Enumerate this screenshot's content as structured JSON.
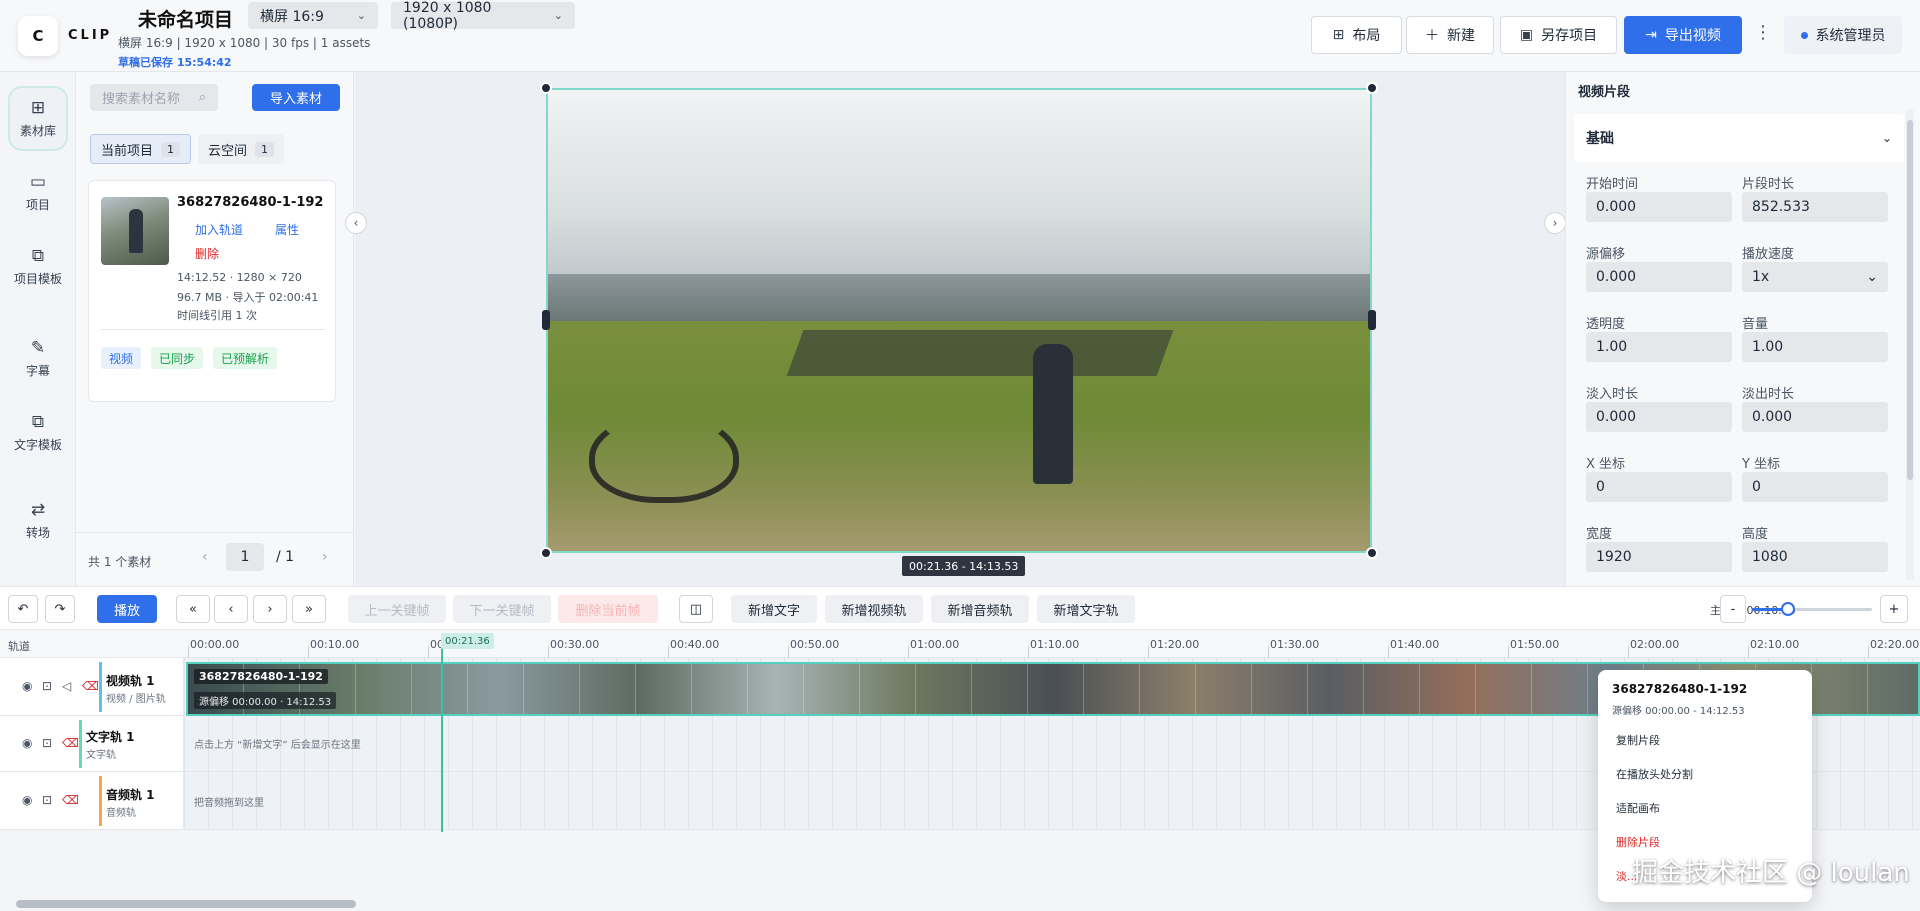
{
  "header": {
    "logo_letter": "C",
    "logo_text": "CLIP",
    "project_title": "未命名项目",
    "project_meta": "横屏 16:9 | 1920 x 1080 | 30 fps | 1 assets",
    "saved_text": "草稿已保存 15:54:42",
    "aspect_select": "横屏 16:9",
    "resolution_select": "1920 x 1080 (1080P)",
    "layout_btn": "布局",
    "new_btn": "新建",
    "save_as_btn": "另存项目",
    "export_btn": "导出视频",
    "admin": "系统管理员"
  },
  "nav": {
    "items": [
      {
        "label": "素材库",
        "icon": "grid-icon"
      },
      {
        "label": "项目",
        "icon": "folder-icon"
      },
      {
        "label": "项目模板",
        "icon": "template-icon"
      },
      {
        "label": "字幕",
        "icon": "pen-icon"
      },
      {
        "label": "文字模板",
        "icon": "text-template-icon"
      },
      {
        "label": "转场",
        "icon": "transition-icon"
      }
    ]
  },
  "assets": {
    "search_placeholder": "搜索素材名称",
    "import_btn": "导入素材",
    "tab_current": "当前项目",
    "tab_current_count": "1",
    "tab_cloud": "云空间",
    "tab_cloud_count": "1",
    "card": {
      "name": "36827826480-1-192",
      "add_to_track": "加入轨道",
      "properties": "属性",
      "delete": "删除",
      "info1": "14:12.52 · 1280 × 720",
      "info2": "96.7 MB · 导入于 02:00:41",
      "info3": "时间线引用 1 次",
      "tag_video": "视频",
      "tag_synced": "已同步",
      "tag_parsed": "已预解析"
    },
    "footer_count": "共 1 个素材",
    "page_current": "1",
    "page_total": "/ 1"
  },
  "preview": {
    "timecode": "00:21.36 - 14:13.53"
  },
  "props": {
    "title": "视频片段",
    "section": "基础",
    "fields": [
      {
        "label": "开始时间",
        "value": "0.000"
      },
      {
        "label": "片段时长",
        "value": "852.533"
      },
      {
        "label": "源偏移",
        "value": "0.000"
      },
      {
        "label": "播放速度",
        "value": "1x"
      },
      {
        "label": "透明度",
        "value": "1.00"
      },
      {
        "label": "音量",
        "value": "1.00"
      },
      {
        "label": "淡入时长",
        "value": "0.000"
      },
      {
        "label": "淡出时长",
        "value": "0.000"
      },
      {
        "label": "X 坐标",
        "value": "0"
      },
      {
        "label": "Y 坐标",
        "value": "0"
      },
      {
        "label": "宽度",
        "value": "1920"
      },
      {
        "label": "高度",
        "value": "1080"
      }
    ]
  },
  "toolbar": {
    "play": "播放",
    "prev_key": "上一关键帧",
    "next_key": "下一关键帧",
    "del_key": "删除当前帧",
    "add_text": "新增文字",
    "add_video_track": "新增视频轨",
    "add_audio_track": "新增音频轨",
    "add_text_track": "新增文字轨",
    "zoom_label": "主刻度 00:10.00",
    "zoom_minus": "-",
    "zoom_plus": "+",
    "zoom_level": 0.3
  },
  "timeline": {
    "header_label": "轨道",
    "ticks": [
      "00:00.00",
      "00:10.00",
      "00:20.00",
      "00:30.00",
      "00:40.00",
      "00:50.00",
      "01:00.00",
      "01:10.00",
      "01:20.00",
      "01:30.00",
      "01:40.00",
      "01:50.00",
      "02:00.00",
      "02:10.00",
      "02:20.00"
    ],
    "playhead_label": "00:21.36",
    "tracks": [
      {
        "name": "视频轨 1",
        "sub": "视频 / 图片轨",
        "color": "#59c4e8"
      },
      {
        "name": "文字轨 1",
        "sub": "文字轨",
        "color": "#6ad6b6",
        "hint": "点击上方 “新增文字” 后会显示在这里"
      },
      {
        "name": "音频轨 1",
        "sub": "音频轨",
        "color": "#f5a54a",
        "hint": "把音频拖到这里"
      }
    ],
    "clip_name": "36827826480-1-192",
    "clip_offset": "源偏移 00:00.00 · 14:12.53"
  },
  "context_menu": {
    "title": "36827826480-1-192",
    "sub": "源偏移 00:00.00 - 14:12.53",
    "items": [
      "复制片段",
      "在播放头处分割",
      "适配画布",
      "删除片段",
      "淡..."
    ]
  },
  "watermark": "掘金技术社区 @ loulan"
}
